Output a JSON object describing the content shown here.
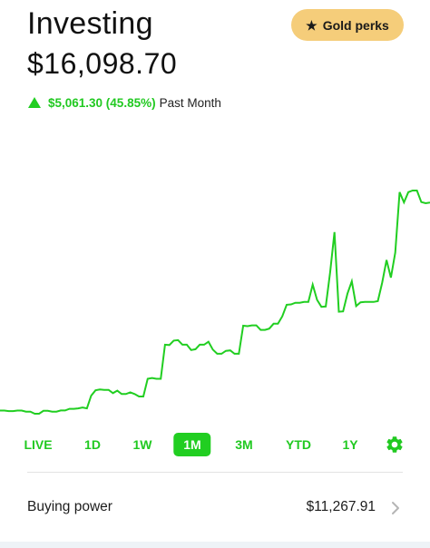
{
  "header": {
    "title": "Investing",
    "gold_button_label": "Gold perks",
    "gold_button_icon": "star-icon",
    "gold_color": "#f5cd7a"
  },
  "portfolio": {
    "value": "$16,098.70",
    "change_amount": "$5,061.30 (45.85%)",
    "change_period": "Past Month",
    "change_direction_icon": "triangle-up-icon"
  },
  "colors": {
    "accent": "#21ce21",
    "text": "#111111"
  },
  "chart_data": {
    "type": "line",
    "period": "1M",
    "series": [
      {
        "values": [
          11037,
          11037,
          11024,
          11024,
          11037,
          11037,
          11010,
          11010,
          10960,
          10960,
          11030,
          11030,
          11010,
          11010,
          11040,
          11040,
          11080,
          11080,
          11090,
          11110,
          11090,
          11400,
          11530,
          11550,
          11540,
          11540,
          11460,
          11520,
          11440,
          11440,
          11480,
          11440,
          11380,
          11380,
          11810,
          11830,
          11810,
          11810,
          12640,
          12630,
          12740,
          12750,
          12640,
          12640,
          12510,
          12530,
          12640,
          12640,
          12710,
          12520,
          12420,
          12420,
          12490,
          12500,
          12420,
          12420,
          13100,
          13090,
          13110,
          13110,
          13000,
          13000,
          13030,
          13150,
          13150,
          13330,
          13610,
          13620,
          13660,
          13660,
          13680,
          13680,
          14100,
          13730,
          13560,
          13570,
          14400,
          15380,
          13440,
          13450,
          13880,
          14180,
          13580,
          13670,
          13680,
          13680,
          13680,
          13700,
          14150,
          14700,
          14270,
          14880,
          16350,
          16100,
          16350,
          16390,
          16390,
          16110,
          16080,
          16098.7
        ]
      }
    ]
  },
  "ranges": {
    "items": [
      {
        "label": "LIVE",
        "active": false
      },
      {
        "label": "1D",
        "active": false
      },
      {
        "label": "1W",
        "active": false
      },
      {
        "label": "1M",
        "active": true
      },
      {
        "label": "3M",
        "active": false
      },
      {
        "label": "YTD",
        "active": false
      },
      {
        "label": "1Y",
        "active": false
      }
    ],
    "settings_icon": "gear-icon"
  },
  "buying_power": {
    "label": "Buying power",
    "value": "$11,267.91",
    "chevron_icon": "chevron-right-icon"
  }
}
